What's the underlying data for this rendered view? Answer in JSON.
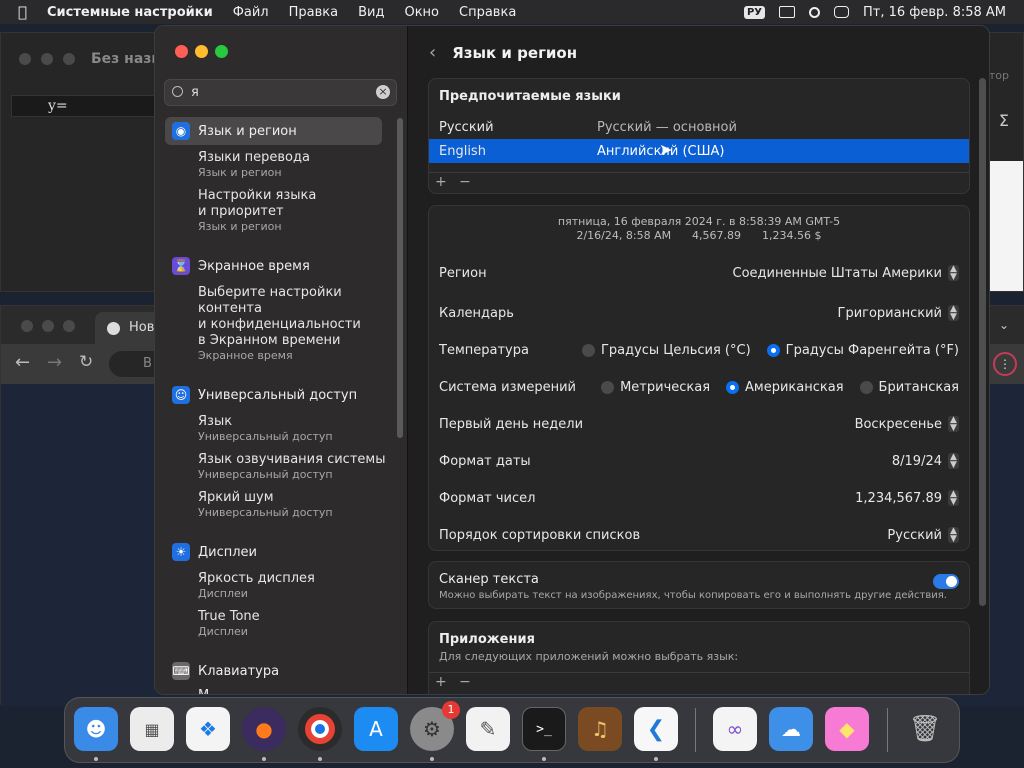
{
  "menubar": {
    "app": "Системные настройки",
    "items": [
      "Файл",
      "Правка",
      "Вид",
      "Окно",
      "Справка"
    ],
    "input_source": "РУ",
    "datetime": "Пт, 16 февр.  8:58 AM"
  },
  "bg": {
    "math_window_title": "Без назв",
    "math_formula": "y=",
    "browser_tab": "Нов",
    "browser_addr": "В",
    "math_right": "тор"
  },
  "sidebar": {
    "search_value": "я",
    "categories": [
      {
        "label": "Язык и регион",
        "icon": "globe-icon",
        "color": "#1f6fe0"
      },
      {
        "label": "Экранное время",
        "icon": "hourglass-icon",
        "color": "#6a4bd6"
      },
      {
        "label": "Универсальный доступ",
        "icon": "accessibility-icon",
        "color": "#1f6fe0"
      },
      {
        "label": "Дисплеи",
        "icon": "sun-icon",
        "color": "#1f6fe0"
      },
      {
        "label": "Клавиатура",
        "icon": "keyboard-icon",
        "color": "#6a6a6a"
      }
    ],
    "subs": {
      "s1": {
        "l1": "Языки перевода",
        "cat": "Язык и регион"
      },
      "s2": {
        "l1": "Настройки языка",
        "l2": "и приоритет",
        "cat": "Язык и регион"
      },
      "s3": {
        "l1": "Выберите настройки",
        "l2": "контента",
        "l3": "и конфиденциальности",
        "l4": "в Экранном времени",
        "cat": "Экранное время"
      },
      "s4": {
        "l1": "Язык",
        "cat": "Универсальный доступ"
      },
      "s5": {
        "l1": "Язык озвучивания системы",
        "cat": "Универсальный доступ"
      },
      "s6": {
        "l1": "Яркий шум",
        "cat": "Универсальный доступ"
      },
      "s7": {
        "l1": "Яркость дисплея",
        "cat": "Дисплеи"
      },
      "s8": {
        "l1": "True Tone",
        "cat": "Дисплеи"
      },
      "s9": {
        "l1": "М"
      }
    }
  },
  "content": {
    "title": "Язык и регион",
    "preferred_title": "Предпочитаемые языки",
    "languages": [
      {
        "name": "Русский",
        "desc": "Русский — основной"
      },
      {
        "name": "English",
        "desc": "Английский (США)"
      }
    ],
    "sample_line1": "пятница, 16 февраля 2024 г. в 8:58:39 AM GMT-5",
    "sample_line2": "2/16/24, 8:58 AM      4,567.89      1,234.56 $",
    "region_label": "Регион",
    "region_value": "Соединенные Штаты Америки",
    "calendar_label": "Календарь",
    "calendar_value": "Григорианский",
    "temp_label": "Температура",
    "temp_c": "Градусы Цельсия (°C)",
    "temp_f": "Градусы Фаренгейта (°F)",
    "measure_label": "Система измерений",
    "measure_metric": "Метрическая",
    "measure_us": "Американская",
    "measure_uk": "Британская",
    "firstday_label": "Первый день недели",
    "firstday_value": "Воскресенье",
    "dateformat_label": "Формат даты",
    "dateformat_value": "8/19/24",
    "numformat_label": "Формат чисел",
    "numformat_value": "1,234,567.89",
    "sort_label": "Порядок сортировки списков",
    "sort_value": "Русский",
    "scanner_title": "Сканер текста",
    "scanner_desc": "Можно выбирать текст на изображениях, чтобы копировать его и выполнять другие действия.",
    "apps_title": "Приложения",
    "apps_desc": "Для следующих приложений можно выбрать язык:"
  },
  "dock": {
    "settings_badge": "1",
    "terminal_prompt": ">_"
  }
}
